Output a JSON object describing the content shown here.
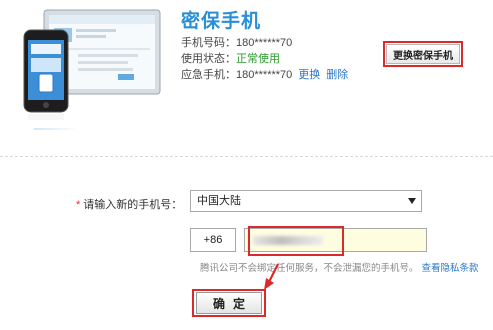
{
  "product": {
    "title": "密保手机",
    "phone_label": "手机号码：",
    "phone_value": "180******70",
    "status_label": "使用状态：",
    "status_value": "正常使用",
    "emergency_label": "应急手机：",
    "emergency_value": "180******70",
    "emergency_change_link": "更换",
    "emergency_delete_link": "删除",
    "change_button_label": "更换密保手机"
  },
  "form": {
    "required_mark": "*",
    "new_phone_label": "请输入新的手机号：",
    "country_selected": "中国大陆",
    "prefix": "+86",
    "phone_value": "",
    "hint_text": "腾讯公司不会绑定任何服务，不会泄漏您的手机号。",
    "privacy_link": "查看隐私条款",
    "confirm_label": "确定"
  },
  "colors": {
    "title_blue": "#2b8fd6",
    "status_green": "#2e9a2e",
    "link_blue": "#2b78c8",
    "highlight_red": "#d92b2b",
    "input_yellow": "#fffde0"
  }
}
